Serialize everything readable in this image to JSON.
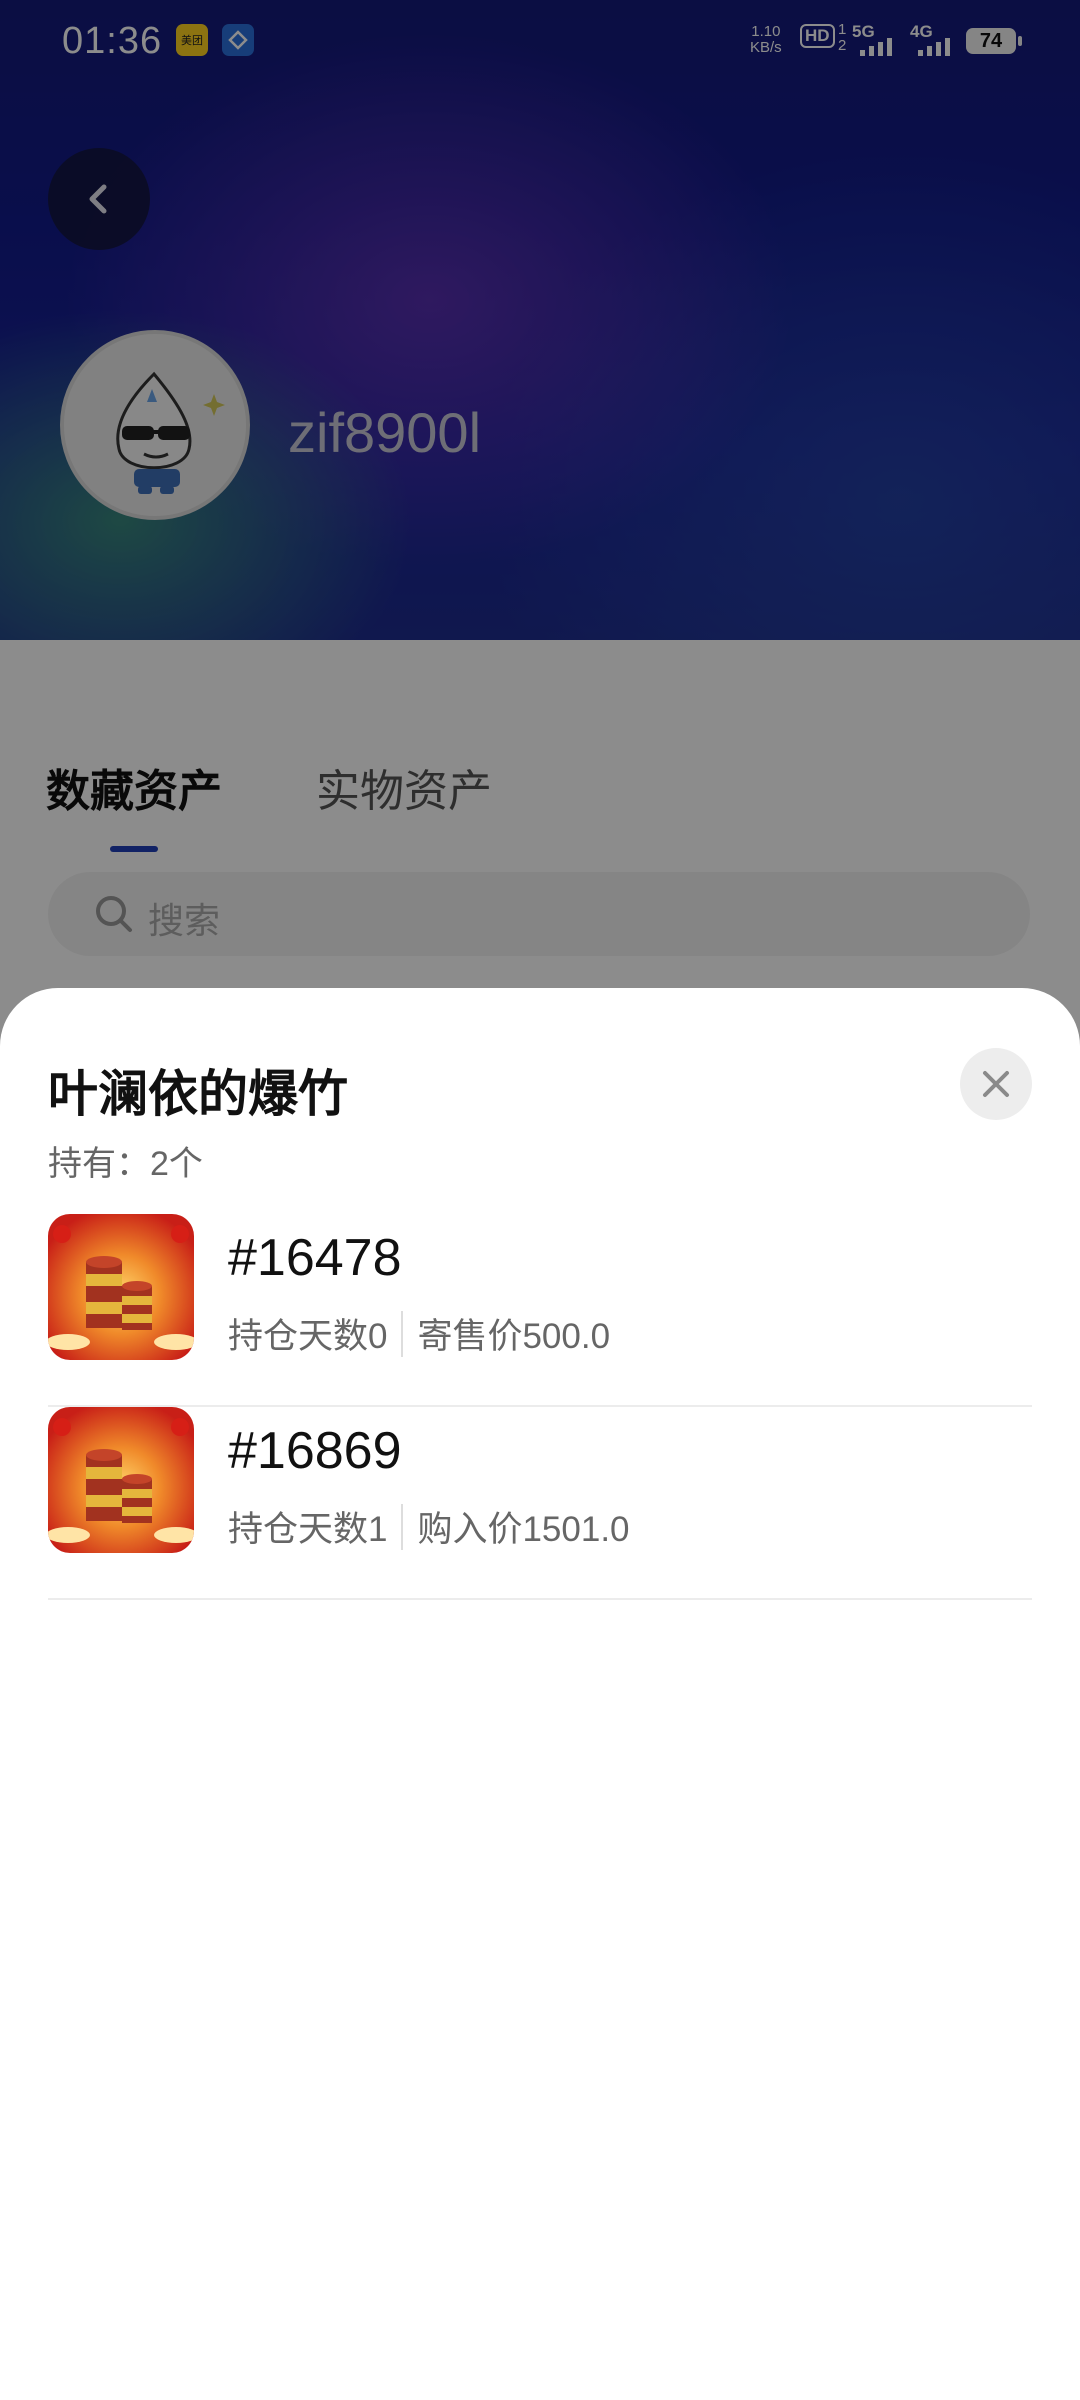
{
  "status_bar": {
    "time": "01:36",
    "net_speed_value": "1.10",
    "net_speed_unit": "KB/s",
    "hd_label": "HD",
    "sim_primary": "1",
    "sim_secondary": "2",
    "sim1_network": "5G",
    "sim2_network": "4G",
    "battery": "74"
  },
  "profile": {
    "username": "zif8900l"
  },
  "tabs": [
    {
      "label": "数藏资产",
      "selected": true
    },
    {
      "label": "实物资产",
      "selected": false
    }
  ],
  "search": {
    "placeholder": "搜索"
  },
  "sheet": {
    "title": "叶澜依的爆竹",
    "holding": "持有：2个",
    "items": [
      {
        "serial": "#16478",
        "days": "持仓天数0",
        "price": "寄售价500.0"
      },
      {
        "serial": "#16869",
        "days": "持仓天数1",
        "price": "购入价1501.0"
      }
    ]
  },
  "colors": {
    "header_gradient_main": "#121b8a",
    "tab_indicator": "#1f3fb8",
    "thumb_background": "#d82a1e"
  },
  "icons": {
    "back": "chevron-left-icon",
    "close": "close-icon",
    "search": "search-icon"
  }
}
